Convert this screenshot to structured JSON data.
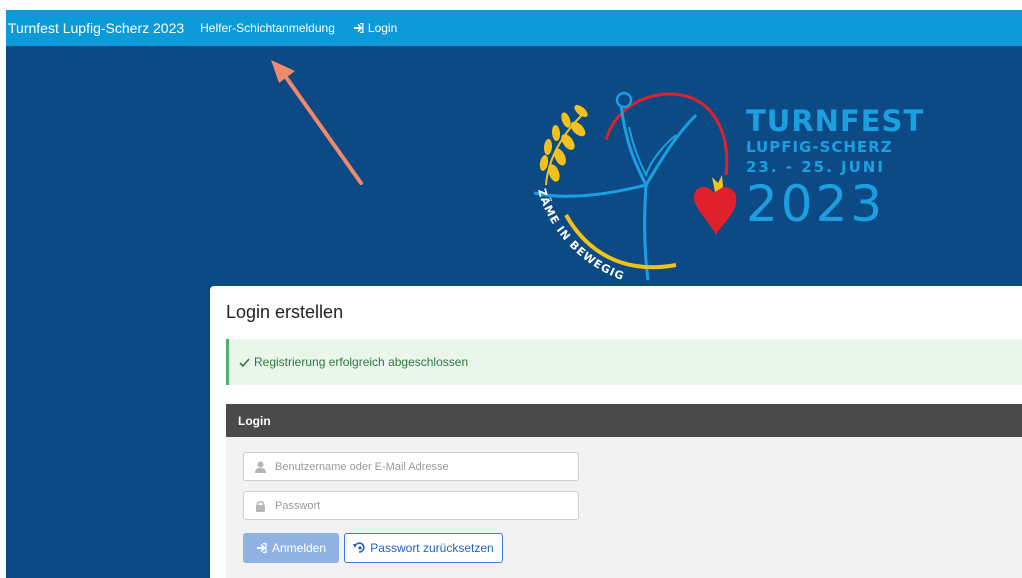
{
  "navbar": {
    "brand": "Turnfest Lupfig-Scherz 2023",
    "links": [
      {
        "label": "Helfer-Schichtanmeldung"
      },
      {
        "label": "Login",
        "icon": "sign-in-icon"
      }
    ]
  },
  "logo": {
    "title": "TURNFEST",
    "location": "LUPFIG-SCHERZ",
    "dates": "23. - 25. JUNI",
    "year": "2023",
    "arc_text": "ZÄME IN BEWEGIG",
    "colors": {
      "text": "#1aa0e0",
      "wheat": "#f3c21a",
      "heart": "#e0202a",
      "figure": "#1aa0e0"
    }
  },
  "annotation": {
    "color": "#f08a6a",
    "icon": "arrow-icon"
  },
  "card": {
    "title": "Login erstellen",
    "alert": {
      "icon": "check-icon",
      "text": "Registrierung erfolgreich abgeschlossen",
      "color": "#2e7a3e"
    },
    "panel": {
      "header": "Login",
      "username": {
        "placeholder": "Benutzername oder E-Mail Adresse",
        "value": "",
        "icon": "user-icon"
      },
      "password": {
        "placeholder": "Passwort",
        "value": "",
        "icon": "lock-icon"
      },
      "login_button": {
        "label": "Anmelden",
        "icon": "sign-in-icon"
      },
      "reset_button": {
        "label": "Passwort zurücksetzen",
        "icon": "reset-key-icon"
      }
    }
  },
  "colors": {
    "navbar": "#0d9ad8",
    "background": "#0c4a86",
    "panel_header": "#4a4a4a",
    "primary_button": "#8fb2e3",
    "outline_button": "#3b7dd8"
  }
}
